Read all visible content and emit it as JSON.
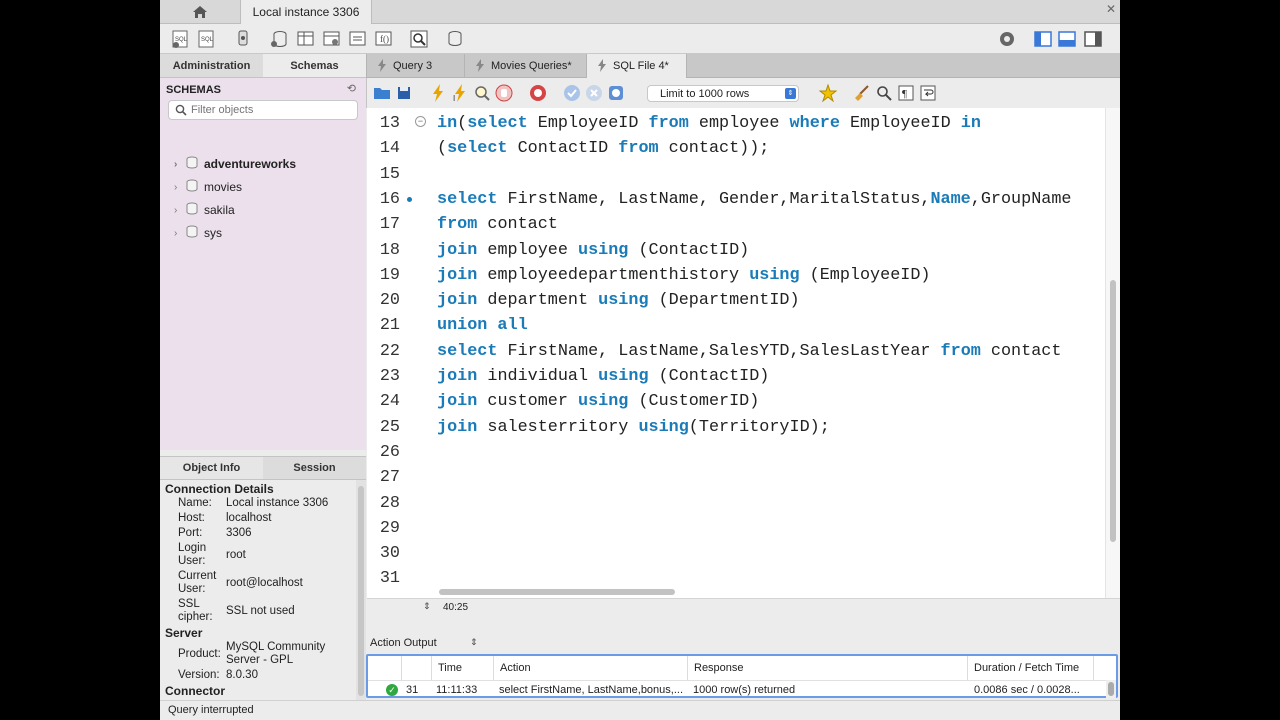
{
  "window": {
    "home_tab_icon": "home-icon",
    "connection_tab": "Local instance 3306"
  },
  "sidebar": {
    "tabs": [
      "Administration",
      "Schemas"
    ],
    "schemas_title": "SCHEMAS",
    "filter_placeholder": "Filter objects",
    "schemas": [
      "adventureworks",
      "movies",
      "sakila",
      "sys"
    ]
  },
  "info": {
    "tabs": [
      "Object Info",
      "Session"
    ],
    "connection_heading": "Connection Details",
    "server_heading": "Server",
    "connector_heading": "Connector",
    "name_label": "Name:",
    "name_value": "Local instance 3306",
    "host_label": "Host:",
    "host_value": "localhost",
    "port_label": "Port:",
    "port_value": "3306",
    "login_label": "Login User:",
    "login_value": "root",
    "current_label": "Current User:",
    "current_value": "root@localhost",
    "ssl_label": "SSL cipher:",
    "ssl_value": "SSL not used",
    "product_label": "Product:",
    "product_value": "MySQL Community Server - GPL",
    "version_label": "Version:",
    "version_value": "8.0.30"
  },
  "editor": {
    "tabs": [
      "Query 3",
      "Movies Queries*",
      "SQL File 4*"
    ],
    "limit_select": "Limit to 1000 rows",
    "cursor_position": "40:25",
    "lines": [
      {
        "n": "13",
        "tokens": [
          [
            "kw",
            "in"
          ],
          [
            "",
            "("
          ],
          [
            "kw",
            "select"
          ],
          [
            "",
            " EmployeeID "
          ],
          [
            "kw",
            "from"
          ],
          [
            "",
            " employee "
          ],
          [
            "kw",
            "where"
          ],
          [
            "",
            " EmployeeID "
          ],
          [
            "kw",
            "in"
          ]
        ]
      },
      {
        "n": "14",
        "tokens": [
          [
            "",
            "("
          ],
          [
            "kw",
            "select"
          ],
          [
            "",
            " ContactID "
          ],
          [
            "kw",
            "from"
          ],
          [
            "",
            " contact));"
          ]
        ]
      },
      {
        "n": "15",
        "tokens": []
      },
      {
        "n": "16",
        "tokens": [
          [
            "kw",
            "select"
          ],
          [
            "",
            " FirstName, LastName, Gender,MaritalStatus,"
          ],
          [
            "kw",
            "Name"
          ],
          [
            "",
            ",GroupName"
          ]
        ]
      },
      {
        "n": "17",
        "tokens": [
          [
            "kw",
            "from"
          ],
          [
            "",
            " contact"
          ]
        ]
      },
      {
        "n": "18",
        "tokens": [
          [
            "kw",
            "join"
          ],
          [
            "",
            " employee "
          ],
          [
            "kw",
            "using"
          ],
          [
            "",
            " (ContactID)"
          ]
        ]
      },
      {
        "n": "19",
        "tokens": [
          [
            "kw",
            "join"
          ],
          [
            "",
            " employeedepartmenthistory "
          ],
          [
            "kw",
            "using"
          ],
          [
            "",
            " (EmployeeID)"
          ]
        ]
      },
      {
        "n": "20",
        "tokens": [
          [
            "kw",
            "join"
          ],
          [
            "",
            " department "
          ],
          [
            "kw",
            "using"
          ],
          [
            "",
            " (DepartmentID)"
          ]
        ]
      },
      {
        "n": "21",
        "tokens": [
          [
            "kw",
            "union all"
          ]
        ]
      },
      {
        "n": "22",
        "tokens": [
          [
            "kw",
            "select"
          ],
          [
            "",
            " FirstName, LastName,SalesYTD,SalesLastYear "
          ],
          [
            "kw",
            "from"
          ],
          [
            "",
            " contact"
          ]
        ]
      },
      {
        "n": "23",
        "tokens": [
          [
            "kw",
            "join"
          ],
          [
            "",
            " individual "
          ],
          [
            "kw",
            "using"
          ],
          [
            "",
            " (ContactID)"
          ]
        ]
      },
      {
        "n": "24",
        "tokens": [
          [
            "kw",
            "join"
          ],
          [
            "",
            " customer "
          ],
          [
            "kw",
            "using"
          ],
          [
            "",
            " (CustomerID)"
          ]
        ]
      },
      {
        "n": "25",
        "tokens": [
          [
            "kw",
            "join"
          ],
          [
            "",
            " salesterritory "
          ],
          [
            "kw",
            "using"
          ],
          [
            "",
            "(TerritoryID);"
          ]
        ]
      },
      {
        "n": "26",
        "tokens": []
      },
      {
        "n": "27",
        "tokens": []
      },
      {
        "n": "28",
        "tokens": []
      },
      {
        "n": "29",
        "tokens": []
      },
      {
        "n": "30",
        "tokens": []
      },
      {
        "n": "31",
        "tokens": []
      }
    ]
  },
  "output": {
    "title": "Action Output",
    "columns": [
      "",
      "Time",
      "Action",
      "Response",
      "Duration / Fetch Time"
    ],
    "rows": [
      {
        "status": "ok",
        "num": "31",
        "time": "11:11:33",
        "action": "select FirstName, LastName,bonus,...",
        "response": "1000 row(s) returned",
        "duration": "0.0086 sec / 0.0028..."
      }
    ]
  },
  "status": {
    "message": "Query interrupted"
  }
}
